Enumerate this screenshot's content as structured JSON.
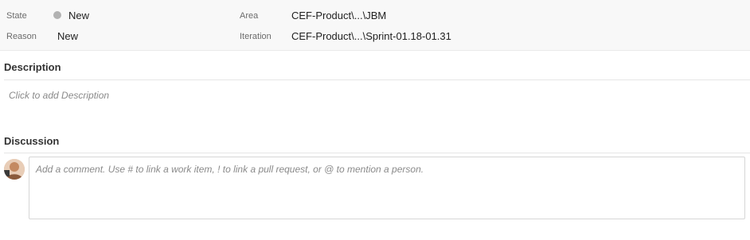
{
  "fields": {
    "state": {
      "label": "State",
      "value": "New"
    },
    "reason": {
      "label": "Reason",
      "value": "New"
    },
    "area": {
      "label": "Area",
      "value": "CEF-Product\\...\\JBM"
    },
    "iteration": {
      "label": "Iteration",
      "value": "CEF-Product\\...\\Sprint-01.18-01.31"
    }
  },
  "description": {
    "title": "Description",
    "placeholder": "Click to add Description"
  },
  "discussion": {
    "title": "Discussion",
    "comment_placeholder": "Add a comment. Use # to link a work item, ! to link a pull request, or @ to mention a person."
  },
  "colors": {
    "state_new_dot": "#b2b2b2",
    "header_bg": "#f8f8f8"
  }
}
